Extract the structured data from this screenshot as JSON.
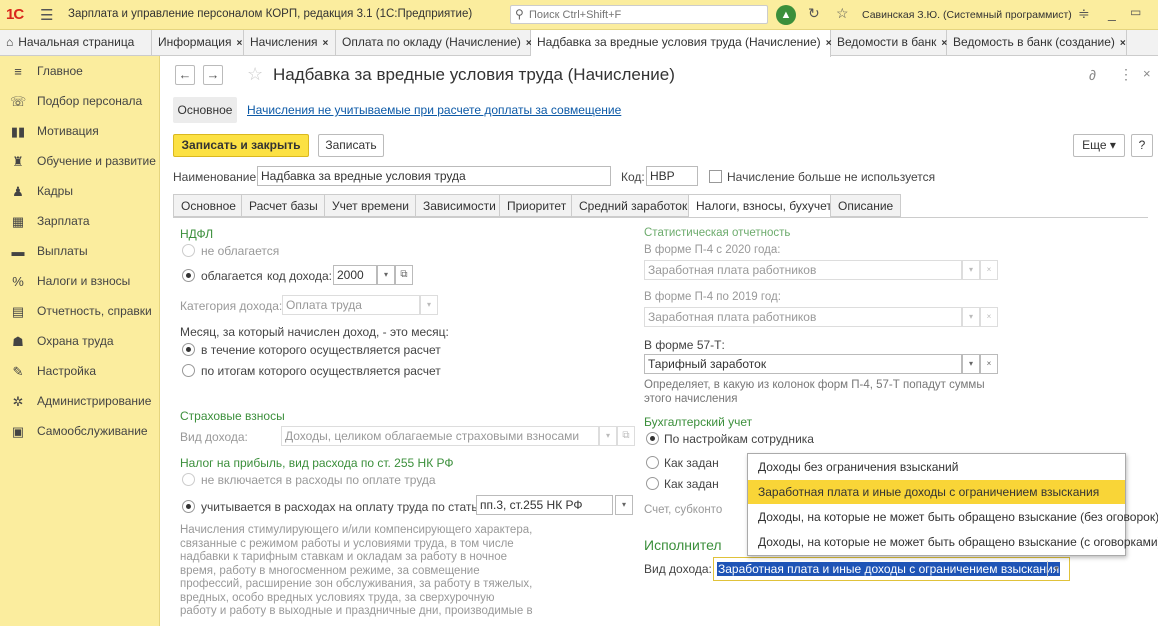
{
  "titlebar": {
    "logo": "1С",
    "app_title": "Зарплата и управление персоналом КОРП, редакция 3.1  (1С:Предприятие)",
    "search_placeholder": "Поиск Ctrl+Shift+F",
    "user": "Савинская З.Ю. (Системный программист)"
  },
  "tabs": [
    {
      "label": "Начальная страница"
    },
    {
      "label": "Информация"
    },
    {
      "label": "Начисления"
    },
    {
      "label": "Оплата по окладу (Начисление)"
    },
    {
      "label": "Надбавка за вредные условия труда (Начисление)"
    },
    {
      "label": "Ведомости в банк"
    },
    {
      "label": "Ведомость в банк (создание)"
    }
  ],
  "sidebar": {
    "items": [
      {
        "label": "Главное",
        "icon": "menu-icon"
      },
      {
        "label": "Подбор персонала",
        "icon": "recruit-icon"
      },
      {
        "label": "Мотивация",
        "icon": "motivation-icon"
      },
      {
        "label": "Обучение и развитие",
        "icon": "education-icon"
      },
      {
        "label": "Кадры",
        "icon": "people-icon"
      },
      {
        "label": "Зарплата",
        "icon": "calculator-icon"
      },
      {
        "label": "Выплаты",
        "icon": "payments-icon"
      },
      {
        "label": "Налоги и взносы",
        "icon": "percent-icon"
      },
      {
        "label": "Отчетность, справки",
        "icon": "reports-icon"
      },
      {
        "label": "Охрана труда",
        "icon": "safety-icon"
      },
      {
        "label": "Настройка",
        "icon": "wrench-icon"
      },
      {
        "label": "Администрирование",
        "icon": "gear-icon"
      },
      {
        "label": "Самообслуживание",
        "icon": "selfservice-icon"
      }
    ]
  },
  "form": {
    "title": "Надбавка за вредные условия труда (Начисление)",
    "subnav_main": "Основное",
    "subnav_link": "Начисления не учитываемые при расчете доплаты за совмещение",
    "save_close": "Записать и закрыть",
    "save": "Записать",
    "more": "Еще",
    "help": "?",
    "name_label": "Наименование:",
    "name_value": "Надбавка за вредные условия труда",
    "code_label": "Код:",
    "code_value": "НВР",
    "unused_label": "Начисление больше не используется",
    "tabs": [
      "Основное",
      "Расчет базы",
      "Учет времени",
      "Зависимости",
      "Приоритет",
      "Средний заработок",
      "Налоги, взносы, бухучет",
      "Описание"
    ]
  },
  "ndfl": {
    "header": "НДФЛ",
    "not_taxed": "не облагается",
    "taxed": "облагается",
    "code_label": "код дохода:",
    "code_value": "2000",
    "category_label": "Категория дохода:",
    "category_value": "Оплата труда",
    "month_label": "Месяц, за который начислен доход, - это месяц:",
    "month_opt1": "в течение которого осуществляется расчет",
    "month_opt2": "по итогам которого осуществляется расчет"
  },
  "insurance": {
    "header": "Страховые взносы",
    "kind_label": "Вид дохода:",
    "kind_value": "Доходы, целиком облагаемые страховыми взносами"
  },
  "profit_tax": {
    "header": "Налог на прибыль, вид расхода по ст. 255 НК РФ",
    "not_included": "не включается в расходы по оплате труда",
    "included": "учитывается в расходах на оплату труда по статье:",
    "article_value": "пп.3, ст.255 НК РФ",
    "description_lines": [
      "Начисления стимулирующего и/или компенсирующего характера,",
      "связанные с режимом работы и условиями труда, в том числе",
      "надбавки к тарифным ставкам и окладам за работу в ночное",
      "время, работу в многосменном режиме, за совмещение",
      "профессий, расширение зон обслуживания, за работу в тяжелых,",
      "вредных, особо вредных условиях труда, за сверхурочную",
      "работу и работу в выходные и праздничные дни, производимые в"
    ]
  },
  "stats": {
    "header": "Статистическая отчетность",
    "p4_2020_label": "В форме П-4 с 2020 года:",
    "p4_2020_value": "Заработная плата работников",
    "p4_2019_label": "В форме П-4 по 2019 год:",
    "p4_2019_value": "Заработная плата работников",
    "f57_label": "В форме 57-Т:",
    "f57_value": "Тарифный заработок",
    "note_line1": "Определяет, в какую из колонок форм П-4, 57-Т попадут суммы",
    "note_line2": "этого начисления"
  },
  "accounting": {
    "header": "Бухгалтерский учет",
    "opt1": "По настройкам сотрудника",
    "opt2": "Как задан",
    "opt3": "Как задан",
    "subconto": "Счет, субконто"
  },
  "enforcement": {
    "header": "Исполнител",
    "kind_label": "Вид дохода:",
    "kind_value": "Заработная плата и иные доходы с ограничением взыскания"
  },
  "popup": {
    "items": [
      "Доходы без ограничения взысканий",
      "Заработная плата и иные доходы с ограничением взыскания",
      "Доходы, на которые не может быть обращено взыскание (без оговорок)",
      "Доходы, на которые не может быть обращено взыскание (с оговорками)"
    ],
    "selected_index": 1
  }
}
